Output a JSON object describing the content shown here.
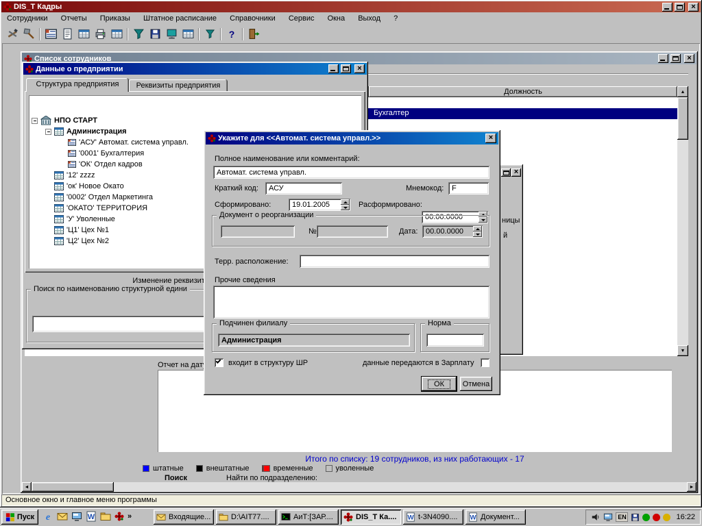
{
  "colors": {
    "active_title_start": "#000080",
    "active_title_end": "#1084d0",
    "main_title_start": "#7a0b0b",
    "main_title_end": "#c96a52",
    "selection": "#000080",
    "summary_text": "#0000cc",
    "chrome": "#c0c0c0"
  },
  "main_window": {
    "title": "DIS_T Кадры",
    "menu": [
      "Сотрудники",
      "Отчеты",
      "Приказы",
      "Штатное расписание",
      "Справочники",
      "Сервис",
      "Окна",
      "Выход",
      "?"
    ],
    "toolbar_icons": [
      "tools",
      "axe",
      "employee-card",
      "list",
      "report",
      "printer",
      "table",
      "filter",
      "save",
      "monitor",
      "grid",
      "filter-small",
      "help",
      "exit"
    ],
    "status_bar": "Основное окно и главное меню программы"
  },
  "employee_list_window": {
    "title": "Список сотрудников",
    "columns": [
      "Должность"
    ],
    "selected_row": "Бухгалтер",
    "report_label": "Отчет на дату",
    "summary": "Итого по списку: 19 сотрудников, из них работающих - 17",
    "legend": [
      {
        "label": "штатные",
        "color": "#0000ff"
      },
      {
        "label": "внештатные",
        "color": "#000000"
      },
      {
        "label": "временные",
        "color": "#7b0000",
        "color2": "#ff0000"
      },
      {
        "label": "уволенные",
        "color": "#c0c0c0"
      }
    ],
    "search_label": "Поиск",
    "find_label": "Найти по подразделению:"
  },
  "company_window": {
    "title": "Данные о предприятии",
    "tabs": [
      "Структура предприятия",
      "Реквизиты предприятия"
    ],
    "tree": [
      {
        "label": "НПО СТАРТ"
      },
      {
        "label": "Администрация"
      },
      {
        "label": "'АСУ' Автомат. система управл."
      },
      {
        "label": "'0001' Бухгалтерия"
      },
      {
        "label": "'ОК' Отдел кадров"
      },
      {
        "label": "'12' zzzz"
      },
      {
        "label": "'ок' Новое Окато"
      },
      {
        "label": "'0002' Отдел Маркетинга"
      },
      {
        "label": "'ОКАТО' ТЕРРИТОРИЯ"
      },
      {
        "label": "'У' Уволенные"
      },
      {
        "label": "'Ц1' Цех №1"
      },
      {
        "label": "'Ц2' Цех №2"
      }
    ],
    "status_text": "Изменение реквизитов структурной",
    "search_group_label": "Поиск по наименованию структурной едини",
    "search_value": ""
  },
  "background_fragment": {
    "text1": "ницы",
    "text2": "й"
  },
  "dialog": {
    "title": "Укажите для <<Автомат. система управл.>>",
    "full_name_label": "Полное наименование или комментарий:",
    "full_name_value": "Автомат. система управл.",
    "short_code_label": "Краткий код:",
    "short_code_value": "АСУ",
    "mnemonic_label": "Мнемокод:",
    "mnemonic_value": "F",
    "formed_label": "Сформировано:",
    "formed_value": "19.01.2005",
    "disbanded_label": "Расформировано:",
    "disbanded_value": "00.00.0000",
    "reorg_group_label": "Документ о реорганизации",
    "reorg_doc_value": "",
    "reorg_no_label": "№",
    "reorg_no_value": "",
    "reorg_date_label": "Дата:",
    "reorg_date_value": "00.00.0000",
    "territory_label": "Терр. расположение:",
    "territory_value": "",
    "other_info_label": "Прочие сведения",
    "other_info_value": "",
    "parent_group_label": "Подчинен филиалу",
    "parent_value": "Администрация",
    "norm_group_label": "Норма",
    "norm_value": "",
    "checkbox_shr_label": "входит в структуру ШР",
    "checkbox_shr_checked": true,
    "checkbox_salary_label": "данные передаются в Зарплату",
    "checkbox_salary_checked": false,
    "ok_label": "ОК",
    "cancel_label": "Отмена"
  },
  "taskbar": {
    "start_label": "Пуск",
    "quicklaunch_icons": [
      "ie",
      "mail",
      "desktop",
      "word",
      "folder",
      "app"
    ],
    "tasks": [
      {
        "label": "Входящие..."
      },
      {
        "label": "D:\\AIT77...."
      },
      {
        "label": "АиТ:[ЗАР...."
      },
      {
        "label": "DIS_T Ка...."
      },
      {
        "label": "t-3N4090...."
      },
      {
        "label": "Документ..."
      }
    ],
    "tray_icons": [
      "volume",
      "display",
      "language",
      "disk",
      "shield",
      "status-red",
      "status-yellow"
    ],
    "language_indicator": "EN",
    "time": "16:22"
  }
}
